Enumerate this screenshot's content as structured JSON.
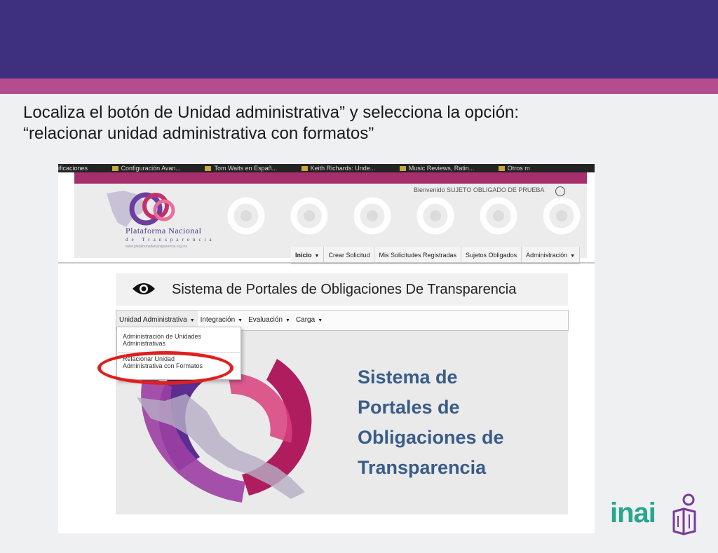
{
  "slide": {
    "instruction_line1": "Localiza el botón de Unidad administrativa” y selecciona la opción:",
    "instruction_line2": "“relacionar unidad administrativa con formatos”",
    "brand_logo_text": "inai",
    "colors": {
      "top_band": "#3f2f7f",
      "accent_band": "#b44d8e",
      "highlight": "#e01f1f",
      "brand": "#2aa58f"
    }
  },
  "browser": {
    "bookmarks": [
      "ificaciones",
      "Configuración Avan...",
      "Tom Waits en Españ...",
      "Keith Richards: Unde...",
      "Music Reviews, Ratin...",
      "Otros m"
    ]
  },
  "site": {
    "logo_line1": "Plataforma Nacional",
    "logo_line2": "de Transparencia",
    "logo_url": "www.plataformadetransparencia.org.mx",
    "welcome": "Bienvenido SUJETO OBLIGADO DE PRUEBA",
    "nav": {
      "inicio": "Inicio",
      "crear": "Crear Solicitud",
      "mis": "Mis Solicitudes Registradas",
      "sujetos": "Sujetos Obligados",
      "admin": "Administración"
    }
  },
  "system": {
    "title": "Sistema de Portales de Obligaciones De Transparencia",
    "menu": {
      "unidad": "Unidad Administrativa",
      "integracion": "Integración",
      "evaluacion": "Evaluación",
      "carga": "Carga"
    },
    "dropdown": {
      "item1_line1": "Administración de Unidades",
      "item1_line2": "Administrativas",
      "item2_line1": "Relacionar Unidad",
      "item2_line2": "Administrativa con Formatos"
    },
    "hero_title": [
      "Sistema de",
      "Portales de",
      "Obligaciones de",
      "Transparencia"
    ]
  }
}
